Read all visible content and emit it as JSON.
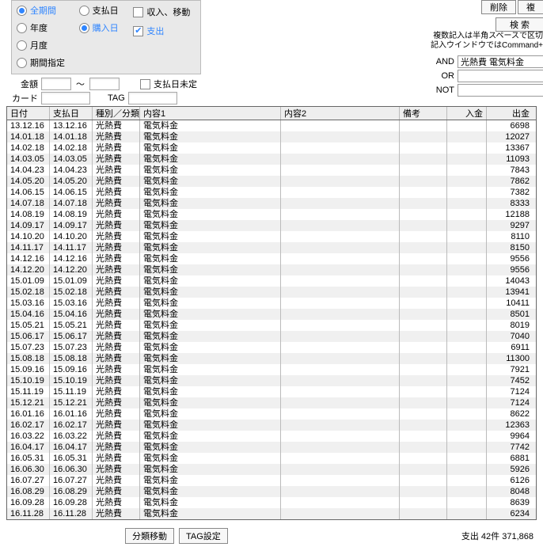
{
  "filters": {
    "period_all": "全期間",
    "year": "年度",
    "month": "月度",
    "range": "期間指定",
    "pay_day": "支払日",
    "buy_day": "購入日",
    "income_move": "収入、移動",
    "expense": "支出"
  },
  "second": {
    "amount_label": "金額",
    "tilde": "〜",
    "pay_undecided": "支払日未定",
    "card_label": "カード",
    "tag_label": "TAG"
  },
  "top_buttons": {
    "delete": "削除",
    "dup": "複",
    "search": "検 索"
  },
  "hint_line1": "複数記入は半角スペースで区切",
  "hint_line2": "記入ウインドウではCommand+",
  "logic": {
    "and": "AND",
    "or": "OR",
    "not": "NOT",
    "and_value": "光熱費 電気料金"
  },
  "table": {
    "headers": {
      "date": "日付",
      "pay": "支払日",
      "cat": "種別／分類",
      "c1": "内容1",
      "c2": "内容2",
      "memo": "備考",
      "in": "入金",
      "out": "出金"
    },
    "rows": [
      {
        "d": "13.12.16",
        "p": "13.12.16",
        "cat": "光熱費",
        "c1": "電気料金",
        "out": "6698"
      },
      {
        "d": "14.01.18",
        "p": "14.01.18",
        "cat": "光熱費",
        "c1": "電気料金",
        "out": "12027"
      },
      {
        "d": "14.02.18",
        "p": "14.02.18",
        "cat": "光熱費",
        "c1": "電気料金",
        "out": "13367"
      },
      {
        "d": "14.03.05",
        "p": "14.03.05",
        "cat": "光熱費",
        "c1": "電気料金",
        "out": "11093"
      },
      {
        "d": "14.04.23",
        "p": "14.04.23",
        "cat": "光熱費",
        "c1": "電気料金",
        "out": "7843"
      },
      {
        "d": "14.05.20",
        "p": "14.05.20",
        "cat": "光熱費",
        "c1": "電気料金",
        "out": "7862"
      },
      {
        "d": "14.06.15",
        "p": "14.06.15",
        "cat": "光熱費",
        "c1": "電気料金",
        "out": "7382"
      },
      {
        "d": "14.07.18",
        "p": "14.07.18",
        "cat": "光熱費",
        "c1": "電気料金",
        "out": "8333"
      },
      {
        "d": "14.08.19",
        "p": "14.08.19",
        "cat": "光熱費",
        "c1": "電気料金",
        "out": "12188"
      },
      {
        "d": "14.09.17",
        "p": "14.09.17",
        "cat": "光熱費",
        "c1": "電気料金",
        "out": "9297"
      },
      {
        "d": "14.10.20",
        "p": "14.10.20",
        "cat": "光熱費",
        "c1": "電気料金",
        "out": "8110"
      },
      {
        "d": "14.11.17",
        "p": "14.11.17",
        "cat": "光熱費",
        "c1": "電気料金",
        "out": "8150"
      },
      {
        "d": "14.12.16",
        "p": "14.12.16",
        "cat": "光熱費",
        "c1": "電気料金",
        "out": "9556"
      },
      {
        "d": "14.12.20",
        "p": "14.12.20",
        "cat": "光熱費",
        "c1": "電気料金",
        "out": "9556"
      },
      {
        "d": "15.01.09",
        "p": "15.01.09",
        "cat": "光熱費",
        "c1": "電気料金",
        "out": "14043"
      },
      {
        "d": "15.02.18",
        "p": "15.02.18",
        "cat": "光熱費",
        "c1": "電気料金",
        "out": "13941"
      },
      {
        "d": "15.03.16",
        "p": "15.03.16",
        "cat": "光熱費",
        "c1": "電気料金",
        "out": "10411"
      },
      {
        "d": "15.04.16",
        "p": "15.04.16",
        "cat": "光熱費",
        "c1": "電気料金",
        "out": "8501"
      },
      {
        "d": "15.05.21",
        "p": "15.05.21",
        "cat": "光熱費",
        "c1": "電気料金",
        "out": "8019"
      },
      {
        "d": "15.06.17",
        "p": "15.06.17",
        "cat": "光熱費",
        "c1": "電気料金",
        "out": "7040"
      },
      {
        "d": "15.07.23",
        "p": "15.07.23",
        "cat": "光熱費",
        "c1": "電気料金",
        "out": "6911"
      },
      {
        "d": "15.08.18",
        "p": "15.08.18",
        "cat": "光熱費",
        "c1": "電気料金",
        "out": "11300"
      },
      {
        "d": "15.09.16",
        "p": "15.09.16",
        "cat": "光熱費",
        "c1": "電気料金",
        "out": "7921"
      },
      {
        "d": "15.10.19",
        "p": "15.10.19",
        "cat": "光熱費",
        "c1": "電気料金",
        "out": "7452"
      },
      {
        "d": "15.11.19",
        "p": "15.11.19",
        "cat": "光熱費",
        "c1": "電気料金",
        "out": "7124"
      },
      {
        "d": "15.12.21",
        "p": "15.12.21",
        "cat": "光熱費",
        "c1": "電気料金",
        "out": "7124"
      },
      {
        "d": "16.01.16",
        "p": "16.01.16",
        "cat": "光熱費",
        "c1": "電気料金",
        "out": "8622"
      },
      {
        "d": "16.02.17",
        "p": "16.02.17",
        "cat": "光熱費",
        "c1": "電気料金",
        "out": "12363"
      },
      {
        "d": "16.03.22",
        "p": "16.03.22",
        "cat": "光熱費",
        "c1": "電気料金",
        "out": "9964"
      },
      {
        "d": "16.04.17",
        "p": "16.04.17",
        "cat": "光熱費",
        "c1": "電気料金",
        "out": "7742"
      },
      {
        "d": "16.05.31",
        "p": "16.05.31",
        "cat": "光熱費",
        "c1": "電気料金",
        "out": "6881"
      },
      {
        "d": "16.06.30",
        "p": "16.06.30",
        "cat": "光熱費",
        "c1": "電気料金",
        "out": "5926"
      },
      {
        "d": "16.07.27",
        "p": "16.07.27",
        "cat": "光熱費",
        "c1": "電気料金",
        "out": "6126"
      },
      {
        "d": "16.08.29",
        "p": "16.08.29",
        "cat": "光熱費",
        "c1": "電気料金",
        "out": "8048"
      },
      {
        "d": "16.09.28",
        "p": "16.09.28",
        "cat": "光熱費",
        "c1": "電気料金",
        "out": "8639"
      },
      {
        "d": "16.11.28",
        "p": "16.11.28",
        "cat": "光熱費",
        "c1": "電気料金",
        "out": "6234"
      }
    ]
  },
  "footer": {
    "move_cat": "分類移動",
    "tag_set": "TAG設定",
    "summary": "支出 42件 371,868"
  }
}
